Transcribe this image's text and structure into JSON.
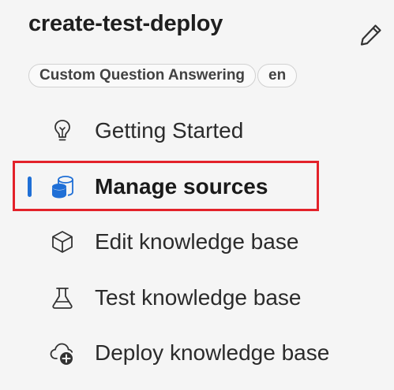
{
  "project": {
    "title": "create-test-deploy",
    "tags": [
      "Custom Question Answering",
      "en"
    ]
  },
  "nav": {
    "items": [
      {
        "label": "Getting Started",
        "icon": "lightbulb-icon"
      },
      {
        "label": "Manage sources",
        "icon": "database-icon",
        "selected": true
      },
      {
        "label": "Edit knowledge base",
        "icon": "cube-icon"
      },
      {
        "label": "Test knowledge base",
        "icon": "beaker-icon"
      },
      {
        "label": "Deploy knowledge base",
        "icon": "cloud-add-icon"
      }
    ]
  },
  "colors": {
    "accent": "#1f6fd6",
    "highlight_border": "#e3222a",
    "background": "#f5f5f5"
  }
}
